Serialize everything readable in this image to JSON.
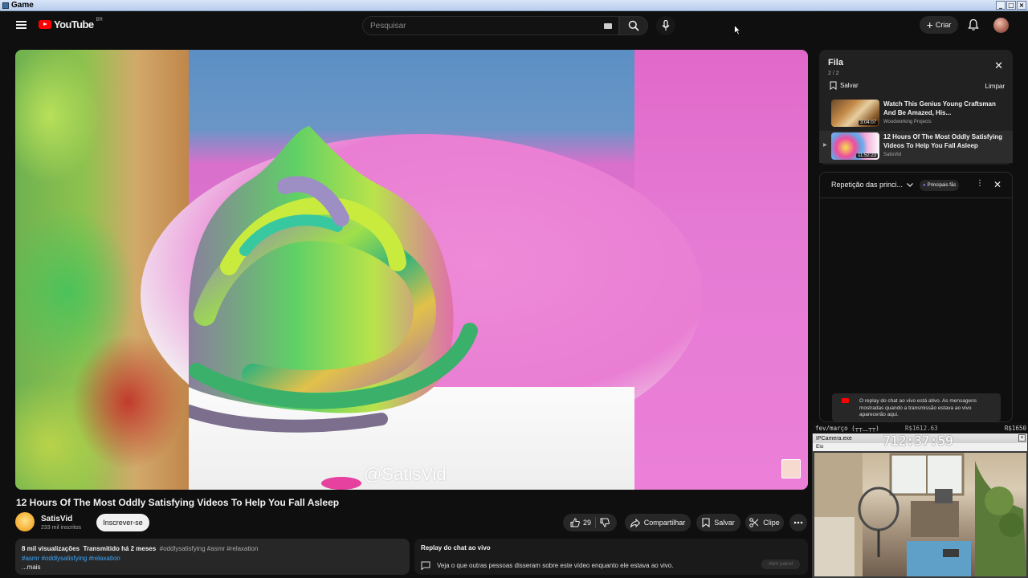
{
  "window": {
    "title": "Game",
    "controls": [
      "_",
      "□",
      "×"
    ]
  },
  "header": {
    "logo_text": "YouTube",
    "logo_country": "BR",
    "search_placeholder": "Pesquisar",
    "create_label": "Criar"
  },
  "video": {
    "watermark": "@SatisVid",
    "title": "12 Hours Of The Most Oddly Satisfying Videos To Help You Fall Asleep",
    "channel_name": "SatisVid",
    "channel_subs": "233 mil inscritos",
    "subscribe_label": "Inscrever-se",
    "likes": "29",
    "share_label": "Compartilhar",
    "save_label": "Salvar",
    "clip_label": "Clipe"
  },
  "description": {
    "views": "8 mil visualizações",
    "streamed": "Transmitido há 2 meses",
    "inline_tags": "#oddlysatisfying #asmr #relaxation",
    "link_tags": "#asmr #oddlysatisfying #relaxation",
    "more": "...mais"
  },
  "chat_replay_box": {
    "title": "Replay do chat ao vivo",
    "text": "Veja o que outras pessoas disseram sobre este vídeo enquanto ele estava ao vivo.",
    "open_panel": "Abrir painel"
  },
  "queue": {
    "title": "Fila",
    "count": "2 / 2",
    "save_label": "Salvar",
    "clear_label": "Limpar",
    "items": [
      {
        "index": "",
        "title": "Watch This Genius Young Craftsman And Be Amazed, His...",
        "channel": "Woodworking Projects",
        "duration": "3:04:07"
      },
      {
        "index": "▶",
        "title": "12 Hours Of The Most Oddly Satisfying Videos To Help You Fall Asleep",
        "channel": "SatisVid",
        "duration": "11:52:23"
      }
    ]
  },
  "chat_panel": {
    "mode": "Repetição das princi...",
    "badge": "Principais fãs",
    "notice": "O replay do chat ao vivo está ativo. As mensagens mostradas quando a transmissão estava ao vivo aparecerão aqui."
  },
  "camera_overlay": {
    "strip_left": "fev/março (┬┬﹏┬┬)",
    "strip_mid": "R$1612.63",
    "strip_right": "R$1650",
    "window_title": "IPCamera.exe",
    "menu": "Eio",
    "timer": "712:37:59"
  },
  "colors": {
    "brand": "#ff0000",
    "background": "#0f0f0f",
    "link": "#3ea6ff",
    "fan_badge": "#8a6fe8"
  }
}
